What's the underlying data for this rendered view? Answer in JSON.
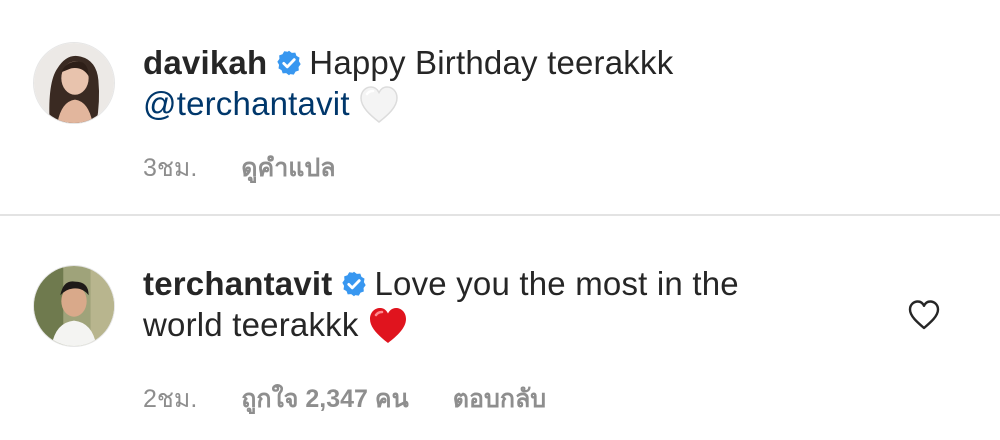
{
  "comments": [
    {
      "username": "davikah",
      "text": "Happy Birthday teerakkk",
      "mention": "@terchantavit",
      "emoji": "white-heart-emoji",
      "time": "3ชม.",
      "translate_label": "ดูคำแปล"
    },
    {
      "username": "terchantavit",
      "text_line1": "Love you the most in the",
      "text_line2": "world teerakkk",
      "emoji": "red-heart-emoji",
      "time": "2ชม.",
      "likes_label": "ถูกใจ 2,347 คน",
      "reply_label": "ตอบกลับ"
    }
  ],
  "colors": {
    "verified": "#3897f0",
    "mention": "#00376b",
    "meta": "#8e8e8e",
    "red_heart": "#e0141e",
    "divider": "#e3e3e3"
  }
}
